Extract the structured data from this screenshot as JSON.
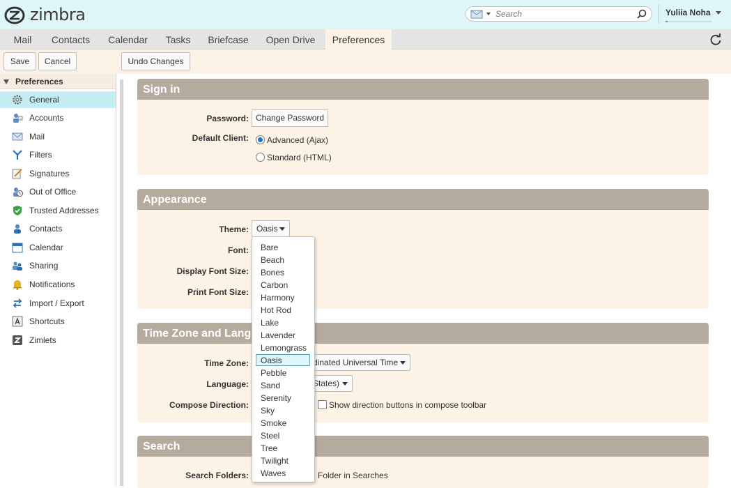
{
  "app": {
    "brand": "zimbra",
    "user_name": "Yuliia Noha",
    "storage_used_fraction": 0.05
  },
  "search": {
    "placeholder": "Search"
  },
  "tabs": [
    {
      "label": "Mail"
    },
    {
      "label": "Contacts"
    },
    {
      "label": "Calendar"
    },
    {
      "label": "Tasks"
    },
    {
      "label": "Briefcase"
    },
    {
      "label": "Open Drive"
    },
    {
      "label": "Preferences"
    }
  ],
  "active_tab": "Preferences",
  "toolbar": {
    "save": "Save",
    "cancel": "Cancel",
    "undo": "Undo Changes"
  },
  "sidebar": {
    "title": "Preferences",
    "items": [
      {
        "label": "General",
        "icon": "gear-icon"
      },
      {
        "label": "Accounts",
        "icon": "accounts-icon"
      },
      {
        "label": "Mail",
        "icon": "mail-icon"
      },
      {
        "label": "Filters",
        "icon": "filter-icon"
      },
      {
        "label": "Signatures",
        "icon": "signature-icon"
      },
      {
        "label": "Out of Office",
        "icon": "out-of-office-icon"
      },
      {
        "label": "Trusted Addresses",
        "icon": "shield-icon"
      },
      {
        "label": "Contacts",
        "icon": "contact-icon"
      },
      {
        "label": "Calendar",
        "icon": "calendar-icon"
      },
      {
        "label": "Sharing",
        "icon": "sharing-icon"
      },
      {
        "label": "Notifications",
        "icon": "bell-icon"
      },
      {
        "label": "Import / Export",
        "icon": "import-export-icon"
      },
      {
        "label": "Shortcuts",
        "icon": "shortcut-icon"
      },
      {
        "label": "Zimlets",
        "icon": "zimlet-icon"
      }
    ],
    "selected": "General"
  },
  "signin": {
    "title": "Sign in",
    "password_label": "Password:",
    "change_password": "Change Password",
    "default_client_label": "Default Client:",
    "option_advanced": "Advanced (Ajax)",
    "option_standard": "Standard (HTML)"
  },
  "appearance": {
    "title": "Appearance",
    "theme_label": "Theme:",
    "theme_value": "Oasis",
    "font_label": "Font:",
    "display_font_size_label": "Display Font Size:",
    "print_font_size_label": "Print Font Size:"
  },
  "timezone": {
    "title": "Time Zone and Lang",
    "timezone_label": "Time Zone:",
    "timezone_value": "dinated Universal Time",
    "language_label": "Language:",
    "language_value": "States)",
    "compose_direction_label": "Compose Direction:",
    "compose_direction_check": "Show direction buttons in compose toolbar"
  },
  "search_section": {
    "title": "Search",
    "search_folders_label": "Search Folders:",
    "search_folders_partial": "Folder in Searches"
  },
  "theme_options": [
    "Bare",
    "Beach",
    "Bones",
    "Carbon",
    "Harmony",
    "Hot Rod",
    "Lake",
    "Lavender",
    "Lemongrass",
    "Oasis",
    "Pebble",
    "Sand",
    "Serenity",
    "Sky",
    "Smoke",
    "Steel",
    "Tree",
    "Twilight",
    "Waves"
  ],
  "colors": {
    "topbar": "#dff6f8",
    "section_header": "#b5aa9e",
    "section_body": "#fdf2e6",
    "selected_item": "#c5eef4"
  }
}
